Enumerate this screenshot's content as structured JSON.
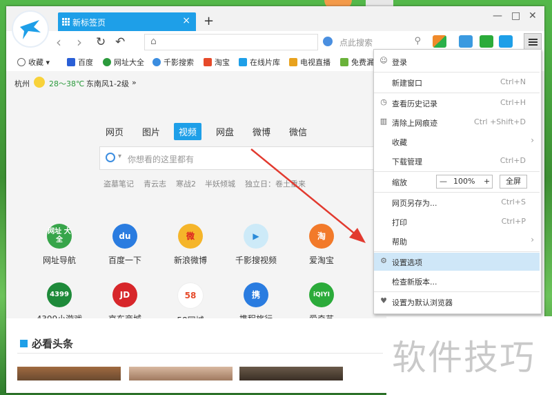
{
  "tab": {
    "title": "新标签页",
    "close": "×",
    "new": "+"
  },
  "window_controls": {
    "minimize": "—",
    "maximize": "□",
    "close": "✕"
  },
  "search_bar": {
    "placeholder": "点此搜索"
  },
  "bookmarks": [
    {
      "label": "收藏",
      "color": "#999"
    },
    {
      "label": "百度",
      "color": "#2a5fd6"
    },
    {
      "label": "网址大全",
      "color": "#2b9a3c"
    },
    {
      "label": "千影搜索",
      "color": "#3b8de0"
    },
    {
      "label": "淘宝",
      "color": "#e64a2a"
    },
    {
      "label": "在线片库",
      "color": "#1e9fe8"
    },
    {
      "label": "电视直播",
      "color": "#e8a21e"
    },
    {
      "label": "免费漏",
      "color": "#6ab23a"
    }
  ],
  "weather": {
    "city": "杭州",
    "temp": "28～38℃",
    "wind": "东南风1-2级",
    "more": "»"
  },
  "search_tabs": [
    "网页",
    "图片",
    "视频",
    "网盘",
    "微博",
    "微信"
  ],
  "search_active": "视频",
  "main_search": {
    "placeholder": "你想看的这里都有"
  },
  "hot_terms": [
    "盗墓笔记",
    "青云志",
    "寒战2",
    "半妖倾城",
    "独立日：卷土重来"
  ],
  "sites_row1": [
    {
      "label": "网址导航",
      "icon": "网址\n大全",
      "color": "#37a54a"
    },
    {
      "label": "百度一下",
      "icon": "du",
      "color": "#2a7ce0"
    },
    {
      "label": "新浪微博",
      "icon": "微",
      "color": "#f5b52a"
    },
    {
      "label": "千影搜视频",
      "icon": "▶",
      "color": "#4db7e8"
    },
    {
      "label": "爱淘宝",
      "icon": "淘",
      "color": "#f27a2a"
    }
  ],
  "sites_row2": [
    {
      "label": "4399小游戏",
      "icon": "4399",
      "color": "#1e8a3a"
    },
    {
      "label": "京东商城",
      "icon": "JD",
      "color": "#d7262a"
    },
    {
      "label": "58同城",
      "icon": "58",
      "color": "#ffffff"
    },
    {
      "label": "携程旅行",
      "icon": "携",
      "color": "#2a7ce0"
    },
    {
      "label": "爱奇艺",
      "icon": "iQIYI",
      "color": "#2bab3a"
    }
  ],
  "news": {
    "title": "必看头条"
  },
  "menu": {
    "login": "登录",
    "new_window": {
      "label": "新建窗口",
      "shortcut": "Ctrl+N"
    },
    "history": {
      "label": "查看历史记录",
      "shortcut": "Ctrl+H"
    },
    "clear": {
      "label": "清除上网痕迹",
      "shortcut": "Ctrl +Shift+D"
    },
    "favorites": {
      "label": "收藏",
      "arrow": "›"
    },
    "downloads": {
      "label": "下载管理",
      "shortcut": "Ctrl+D"
    },
    "zoom": {
      "label": "缩放",
      "minus": "—",
      "value": "100%",
      "plus": "+",
      "full": "全屏"
    },
    "save_as": {
      "label": "网页另存为...",
      "shortcut": "Ctrl+S"
    },
    "print": {
      "label": "打印",
      "shortcut": "Ctrl+P"
    },
    "help": {
      "label": "帮助",
      "arrow": "›"
    },
    "settings": {
      "label": "设置选项"
    },
    "update": {
      "label": "检查新版本..."
    },
    "default": {
      "label": "设置为默认浏览器"
    }
  },
  "watermark": "软件技巧"
}
